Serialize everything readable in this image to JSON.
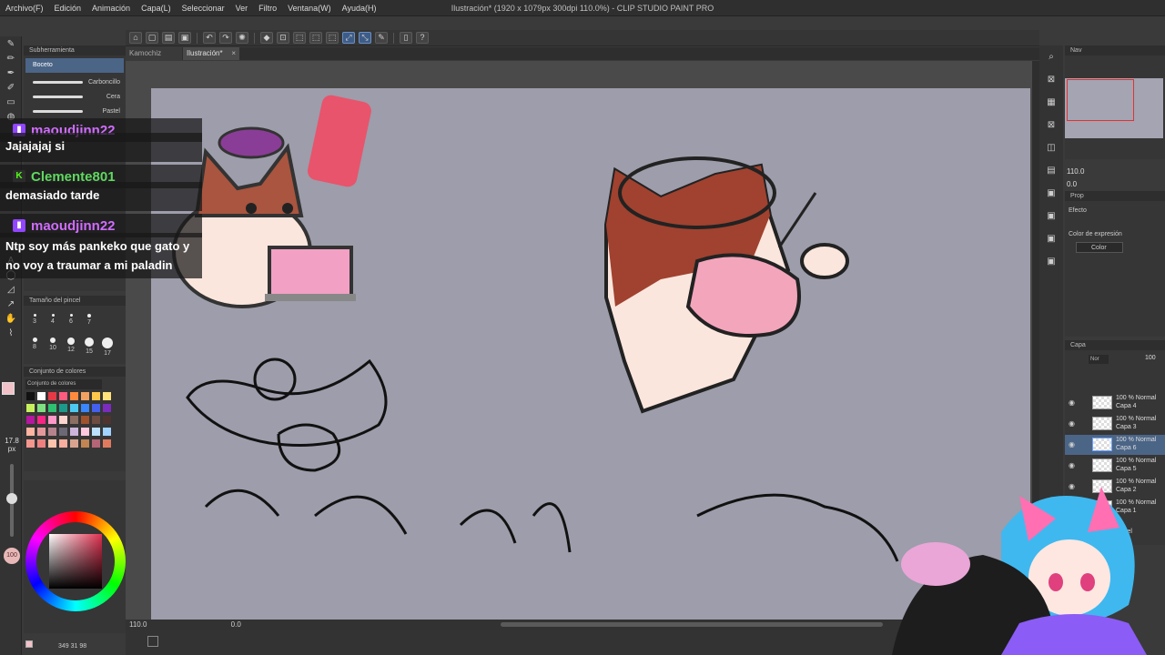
{
  "window": {
    "title": "Ilustración* (1920 x 1079px 300dpi 110.0%) - CLIP STUDIO PAINT PRO"
  },
  "menubar": [
    "Archivo(F)",
    "Edición",
    "Animación",
    "Capa(L)",
    "Seleccionar",
    "Ver",
    "Filtro",
    "Ventana(W)",
    "Ayuda(H)"
  ],
  "tabs": [
    {
      "label": "Kamochiz",
      "active": false
    },
    {
      "label": "Ilustración*",
      "active": true,
      "close": "×"
    }
  ],
  "subtool": {
    "title": "Subherramienta",
    "selected": "Boceto",
    "brushes": [
      "Carboncillo",
      "Cera",
      "Pastel"
    ]
  },
  "brush_size": {
    "title": "Tamaño del pincel",
    "sizes": [
      "3",
      "4",
      "6",
      "7",
      "8",
      "10",
      "12",
      "15",
      "17"
    ]
  },
  "color_set": {
    "title": "Conjunto de colores",
    "preset": "Conjunto de colores predeter..."
  },
  "left_status": {
    "size": "17.8",
    "unit": "px",
    "zoom": "100"
  },
  "chat": [
    {
      "user": "maoudjinn22",
      "color": "#d06cff",
      "badge": "▮",
      "message": "Jajajajaj si"
    },
    {
      "user": "Clemente801",
      "color": "#60d860",
      "badge": "K",
      "message": "demasiado tarde"
    },
    {
      "user": "maoudjinn22",
      "color": "#d06cff",
      "badge": "▮",
      "message": "Ntp soy más pankeko que gato y no voy a traumar a mi paladin"
    }
  ],
  "status": {
    "zoom": "110.0",
    "angle": "0.0",
    "coords": "349  31  98"
  },
  "navigator": {
    "title": "Nav",
    "zoom": "110.0",
    "angle": "0.0"
  },
  "properties": {
    "title": "Prop",
    "effect_label": "Efecto",
    "expression_label": "Color de expresión",
    "expression_value": "Color"
  },
  "layers": {
    "title": "Capa",
    "blend": "Nor",
    "opacity": "100",
    "rows": [
      {
        "mode": "100 % Normal",
        "name": "Capa 4",
        "selected": false
      },
      {
        "mode": "100 % Normal",
        "name": "Capa 3",
        "selected": false
      },
      {
        "mode": "100 % Normal",
        "name": "Capa 6",
        "selected": true
      },
      {
        "mode": "100 % Normal",
        "name": "Capa 5",
        "selected": false
      },
      {
        "mode": "100 % Normal",
        "name": "Capa 2",
        "selected": false
      },
      {
        "mode": "100 % Normal",
        "name": "Capa 1",
        "selected": false
      },
      {
        "mode": "",
        "name": "Papel",
        "selected": false
      }
    ]
  },
  "colors": {
    "accent": "#4b6587",
    "canvas": "#9d9dab",
    "selection_red": "#e23232"
  }
}
